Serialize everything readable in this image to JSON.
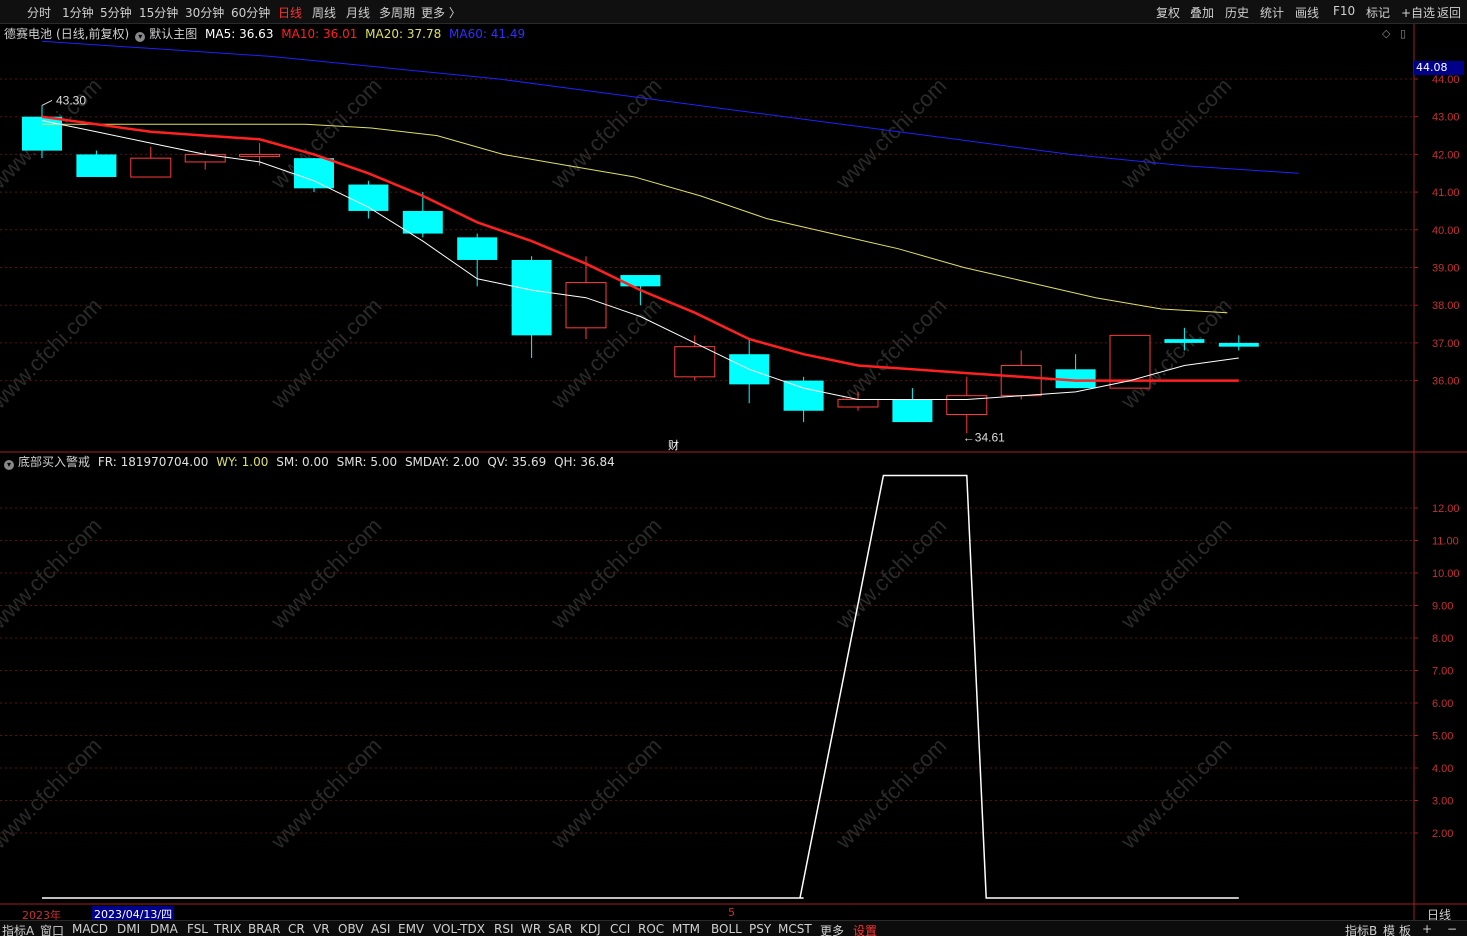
{
  "toolbar": {
    "left": [
      "分时",
      "1分钟",
      "5分钟",
      "15分钟",
      "30分钟",
      "60分钟",
      "日线",
      "周线",
      "月线",
      "多周期",
      "更多 〉"
    ],
    "active": "日线",
    "right": [
      "复权",
      "叠加",
      "历史",
      "统计",
      "画线",
      "F10",
      "标记",
      "+自选",
      "返回"
    ]
  },
  "main_panel": {
    "stock_name": "德赛电池",
    "mode": "(日线,前复权)",
    "template": "默认主图",
    "ma5": "MA5: 36.63",
    "ma10": "MA10: 36.01",
    "ma20": "MA20: 37.78",
    "ma60": "MA60: 41.49",
    "high_label": "43.30",
    "low_label": "34.61",
    "finance_marker": "财",
    "last_price_tag": "44.08",
    "y_ticks": [
      "44.00",
      "43.00",
      "42.00",
      "41.00",
      "40.00",
      "39.00",
      "38.00",
      "37.00",
      "36.00"
    ]
  },
  "sub_panel": {
    "indicator": "底部买入警戒",
    "fr": "FR: 181970704.00",
    "wy": "WY: 1.00",
    "sm": "SM: 0.00",
    "smr": "SMR: 5.00",
    "smday": "SMDAY: 2.00",
    "qv": "QV: 35.69",
    "qh": "QH: 36.84",
    "y_ticks": [
      "12.00",
      "11.00",
      "10.00",
      "9.00",
      "8.00",
      "7.00",
      "6.00",
      "5.00",
      "4.00",
      "3.00",
      "2.00"
    ]
  },
  "date_axis": {
    "year": "2023年",
    "cursor_date": "2023/04/13/四",
    "month_mark": "5",
    "period": "日线"
  },
  "bottombar": {
    "left": [
      "指标A",
      "窗口",
      "MACD",
      "DMI",
      "DMA",
      "FSL",
      "TRIX",
      "BRAR",
      "CR",
      "VR",
      "OBV",
      "ASI",
      "EMV",
      "VOL-TDX",
      "RSI",
      "WR",
      "SAR",
      "KDJ",
      "CCI",
      "ROC",
      "MTM",
      "BOLL",
      "PSY",
      "MCST",
      "更多",
      "设置"
    ],
    "active": "设置",
    "right": [
      "指标B",
      "模",
      "板",
      "+",
      "−"
    ]
  },
  "watermark": "www.cfchi.com",
  "colors": {
    "up": "#ff3c3c",
    "down": "#00ffff",
    "ma5": "#ffffff",
    "ma10": "#ff2020",
    "ma20": "#e0e060",
    "ma60": "#2020ff",
    "axis": "#c83030"
  },
  "chart_data": {
    "type": "candlestick",
    "ylim": [
      35.0,
      44.5
    ],
    "candles": [
      {
        "o": 43.0,
        "c": 42.1,
        "h": 43.3,
        "l": 41.9
      },
      {
        "o": 42.0,
        "c": 41.4,
        "h": 42.1,
        "l": 41.4
      },
      {
        "o": 41.4,
        "c": 41.9,
        "h": 42.2,
        "l": 41.4
      },
      {
        "o": 41.8,
        "c": 42.0,
        "h": 42.1,
        "l": 41.6
      },
      {
        "o": 42.0,
        "c": 42.0,
        "h": 42.3,
        "l": 41.7
      },
      {
        "o": 41.9,
        "c": 41.1,
        "h": 41.9,
        "l": 41.0
      },
      {
        "o": 41.2,
        "c": 40.5,
        "h": 41.3,
        "l": 40.3
      },
      {
        "o": 40.5,
        "c": 39.9,
        "h": 41.0,
        "l": 39.8
      },
      {
        "o": 39.8,
        "c": 39.2,
        "h": 39.9,
        "l": 38.5
      },
      {
        "o": 39.2,
        "c": 37.2,
        "h": 39.3,
        "l": 36.6
      },
      {
        "o": 37.4,
        "c": 38.6,
        "h": 39.3,
        "l": 37.1
      },
      {
        "o": 38.8,
        "c": 38.5,
        "h": 38.8,
        "l": 38.0
      },
      {
        "o": 36.1,
        "c": 36.9,
        "h": 37.2,
        "l": 36.0
      },
      {
        "o": 36.7,
        "c": 35.9,
        "h": 37.1,
        "l": 35.4
      },
      {
        "o": 36.0,
        "c": 35.2,
        "h": 36.1,
        "l": 34.9
      },
      {
        "o": 35.3,
        "c": 35.5,
        "h": 35.7,
        "l": 35.2
      },
      {
        "o": 35.5,
        "c": 34.9,
        "h": 35.8,
        "l": 34.9
      },
      {
        "o": 35.1,
        "c": 35.6,
        "h": 36.1,
        "l": 34.6
      },
      {
        "o": 35.6,
        "c": 36.4,
        "h": 36.8,
        "l": 35.5
      },
      {
        "o": 36.3,
        "c": 35.8,
        "h": 36.7,
        "l": 35.8
      },
      {
        "o": 35.8,
        "c": 37.2,
        "h": 37.2,
        "l": 35.8
      },
      {
        "o": 37.1,
        "c": 37.0,
        "h": 37.4,
        "l": 36.8
      },
      {
        "o": 37.0,
        "c": 36.9,
        "h": 37.2,
        "l": 36.8
      }
    ],
    "ma5": [
      42.9,
      42.6,
      42.3,
      42.0,
      41.8,
      41.3,
      40.6,
      39.7,
      38.7,
      38.4,
      38.2,
      37.7,
      37.0,
      36.3,
      35.8,
      35.5,
      35.5,
      35.5,
      35.6,
      35.7,
      36.0,
      36.4,
      36.6
    ],
    "ma10": [
      43.0,
      42.8,
      42.6,
      42.5,
      42.4,
      42.0,
      41.5,
      40.9,
      40.2,
      39.7,
      39.1,
      38.4,
      37.8,
      37.1,
      36.7,
      36.4,
      36.3,
      36.2,
      36.1,
      36.0,
      36.0,
      36.0,
      36.0
    ],
    "ma20": [
      42.8,
      42.8,
      42.8,
      42.8,
      42.8,
      42.7,
      42.5,
      42.0,
      41.7,
      41.4,
      40.9,
      40.3,
      39.9,
      39.5,
      39.0,
      38.6,
      38.2,
      37.9,
      37.8
    ],
    "ma60": [
      45.0,
      44.8,
      44.6,
      44.3,
      44.0,
      43.6,
      43.2,
      42.8,
      42.4,
      42.0,
      41.7,
      41.5
    ],
    "indicator": [
      0,
      0,
      0,
      0,
      0,
      0,
      0,
      0,
      0,
      0,
      0,
      0,
      0,
      0,
      0,
      0,
      13,
      13,
      0,
      0,
      0,
      0,
      0
    ]
  }
}
